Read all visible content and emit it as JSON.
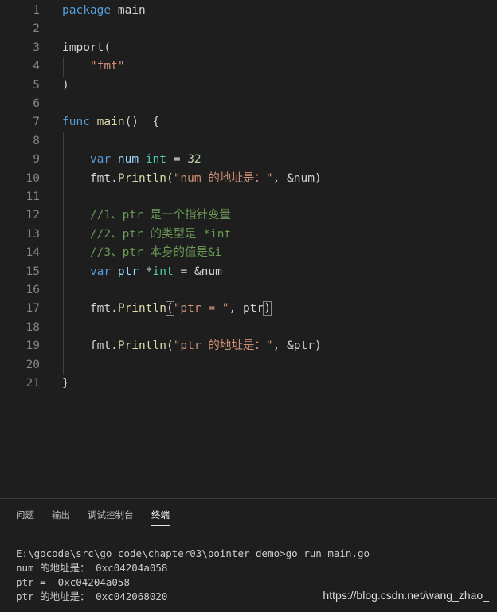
{
  "editor": {
    "lines": [
      {
        "n": "1",
        "tokens": [
          [
            "kw",
            "package"
          ],
          [
            "plain",
            " main"
          ]
        ]
      },
      {
        "n": "2",
        "tokens": []
      },
      {
        "n": "3",
        "tokens": [
          [
            "plain",
            "import("
          ]
        ]
      },
      {
        "n": "4",
        "tokens": [
          [
            "plain",
            "    "
          ],
          [
            "str",
            "\"fmt\""
          ]
        ]
      },
      {
        "n": "5",
        "tokens": [
          [
            "plain",
            ")"
          ]
        ]
      },
      {
        "n": "6",
        "tokens": []
      },
      {
        "n": "7",
        "tokens": [
          [
            "kw",
            "func"
          ],
          [
            "plain",
            " "
          ],
          [
            "fn",
            "main"
          ],
          [
            "plain",
            "()  {"
          ]
        ]
      },
      {
        "n": "8",
        "tokens": []
      },
      {
        "n": "9",
        "tokens": [
          [
            "plain",
            "    "
          ],
          [
            "kw",
            "var"
          ],
          [
            "plain",
            " "
          ],
          [
            "var",
            "num"
          ],
          [
            "plain",
            " "
          ],
          [
            "typ",
            "int"
          ],
          [
            "plain",
            " = "
          ],
          [
            "num",
            "32"
          ]
        ]
      },
      {
        "n": "10",
        "tokens": [
          [
            "plain",
            "    fmt."
          ],
          [
            "fn",
            "Println"
          ],
          [
            "plain",
            "("
          ],
          [
            "str",
            "\"num 的地址是：\""
          ],
          [
            "plain",
            ", &num)"
          ]
        ]
      },
      {
        "n": "11",
        "tokens": []
      },
      {
        "n": "12",
        "tokens": [
          [
            "plain",
            "    "
          ],
          [
            "cmt",
            "//1、ptr 是一个指针变量"
          ]
        ]
      },
      {
        "n": "13",
        "tokens": [
          [
            "plain",
            "    "
          ],
          [
            "cmt",
            "//2、ptr 的类型是 *int"
          ]
        ]
      },
      {
        "n": "14",
        "tokens": [
          [
            "plain",
            "    "
          ],
          [
            "cmt",
            "//3、ptr 本身的值是&i"
          ]
        ]
      },
      {
        "n": "15",
        "tokens": [
          [
            "plain",
            "    "
          ],
          [
            "kw",
            "var"
          ],
          [
            "plain",
            " "
          ],
          [
            "var",
            "ptr"
          ],
          [
            "plain",
            " *"
          ],
          [
            "typ",
            "int"
          ],
          [
            "plain",
            " = &num"
          ]
        ]
      },
      {
        "n": "16",
        "tokens": []
      },
      {
        "n": "17",
        "tokens": [
          [
            "plain",
            "    fmt."
          ],
          [
            "fn",
            "Println"
          ],
          [
            "hl",
            "("
          ],
          [
            "str",
            "\"ptr = \""
          ],
          [
            "plain",
            ", ptr"
          ],
          [
            "hl",
            ")"
          ]
        ]
      },
      {
        "n": "18",
        "tokens": []
      },
      {
        "n": "19",
        "tokens": [
          [
            "plain",
            "    fmt."
          ],
          [
            "fn",
            "Println"
          ],
          [
            "plain",
            "("
          ],
          [
            "str",
            "\"ptr 的地址是：\""
          ],
          [
            "plain",
            ", &ptr)"
          ]
        ]
      },
      {
        "n": "20",
        "tokens": []
      },
      {
        "n": "21",
        "tokens": [
          [
            "plain",
            "}"
          ]
        ]
      }
    ]
  },
  "panel": {
    "tabs": [
      {
        "label": "问题",
        "active": false
      },
      {
        "label": "输出",
        "active": false
      },
      {
        "label": "调试控制台",
        "active": false
      },
      {
        "label": "终端",
        "active": true
      }
    ],
    "terminal": [
      "E:\\gocode\\src\\go_code\\chapter03\\pointer_demo>go run main.go",
      "num 的地址是： 0xc04204a058",
      "ptr =  0xc04204a058",
      "ptr 的地址是： 0xc042068020"
    ]
  },
  "watermark": "https://blog.csdn.net/wang_zhao_"
}
